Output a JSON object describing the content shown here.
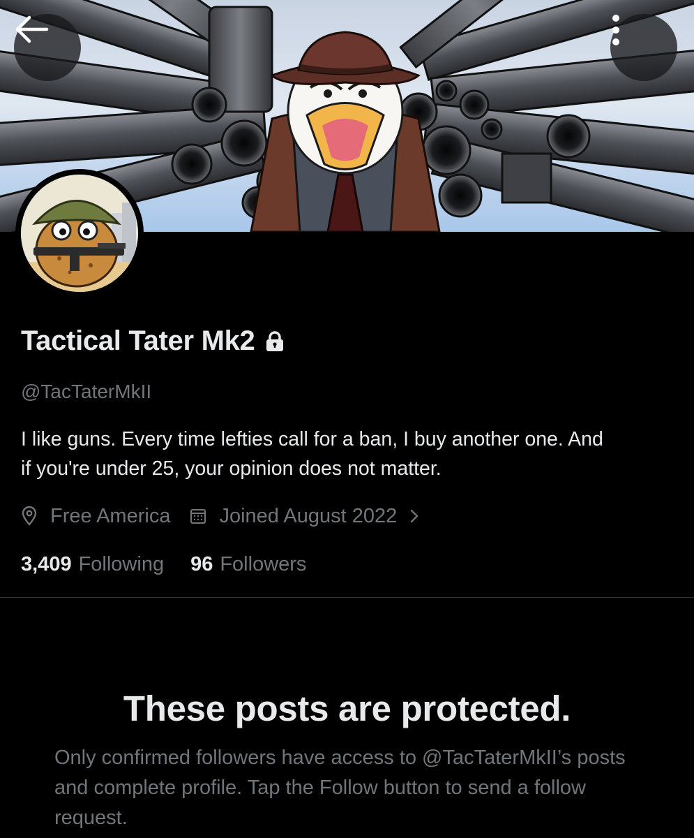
{
  "header": {
    "back_icon": "arrow-left-icon",
    "more_icon": "more-vertical-icon",
    "banner_colors": {
      "sky": "#c9d4e3",
      "metal": "#55585e",
      "coat": "#6b3a2a"
    }
  },
  "profile": {
    "name": "Tactical Tater Mk2",
    "protected_icon": "lock-icon",
    "handle": "@TacTaterMkII",
    "bio_line1": "I like guns. Every time lefties call for a ban, I buy another one.  And",
    "bio_line2": "if you're under 25, your opinion does not matter.",
    "location": "Free America",
    "joined": "Joined August 2022",
    "following_count": "3,409",
    "following_label": "Following",
    "followers_count": "96",
    "followers_label": "Followers"
  },
  "protected": {
    "title": "These posts are protected.",
    "body": "Only confirmed followers have access to @TacTaterMkII’s posts and complete profile. Tap the Follow button to send a follow request."
  },
  "colors": {
    "background": "#000000",
    "primary_text": "#e7e9ea",
    "secondary_text": "#71767b",
    "divider": "#2f3336"
  }
}
